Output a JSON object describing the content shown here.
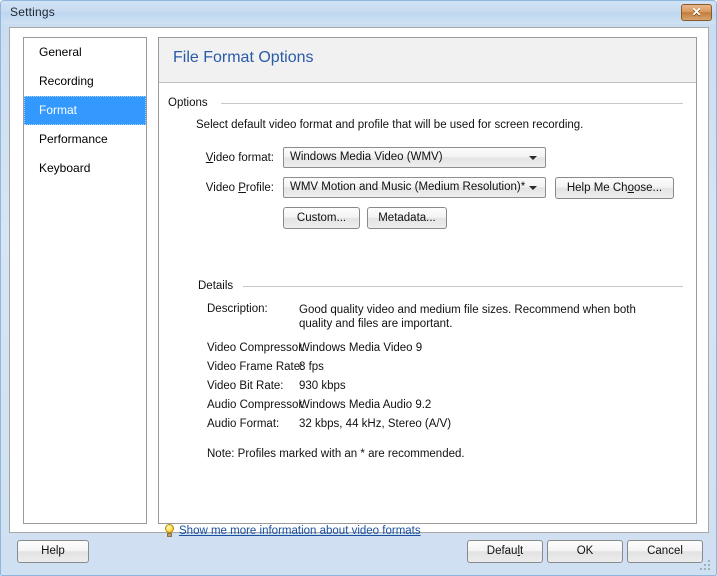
{
  "window": {
    "title": "Settings",
    "close_label": "✕",
    "accent_selected": "#3399ff",
    "title_color": "#2a5aa8",
    "link_color": "#1a4fa0"
  },
  "sidebar": {
    "items": [
      {
        "label": "General",
        "selected": false
      },
      {
        "label": "Recording",
        "selected": false
      },
      {
        "label": "Format",
        "selected": true
      },
      {
        "label": "Performance",
        "selected": false
      },
      {
        "label": "Keyboard",
        "selected": false
      }
    ]
  },
  "pane": {
    "header_title": "File Format Options",
    "options_group": {
      "legend": "Options",
      "intro": "Select default video format and profile that will be used for screen recording.",
      "video_format": {
        "label_pre": "",
        "label_accel": "V",
        "label_post": "ideo format:",
        "label_full": "Video format:",
        "value": "Windows Media Video (WMV)"
      },
      "video_profile": {
        "label_pre": "Video ",
        "label_accel": "P",
        "label_post": "rofile:",
        "label_full": "Video Profile:",
        "value": "WMV Motion and Music (Medium Resolution)*"
      },
      "help_me_choose": {
        "pre": "Help Me Ch",
        "accel": "o",
        "post": "ose...",
        "full": "Help Me Choose..."
      },
      "custom_button": "Custom...",
      "metadata_button": "Metadata..."
    },
    "details_group": {
      "legend": "Details",
      "rows": [
        {
          "label": "Description:",
          "value": "Good quality video and medium file sizes.  Recommend when both quality and files are important."
        },
        {
          "label": "Video Compressor:",
          "value": "Windows Media Video 9"
        },
        {
          "label": "Video Frame Rate:",
          "value": "8 fps"
        },
        {
          "label": "Video Bit Rate:",
          "value": "930 kbps"
        },
        {
          "label": "Audio Compressor:",
          "value": "Windows Media Audio 9.2"
        },
        {
          "label": "Audio Format:",
          "value": "32 kbps, 44 kHz, Stereo (A/V)"
        }
      ],
      "note": "Note:  Profiles marked with an *  are recommended."
    },
    "more_info_link": "Show me more information about video formats"
  },
  "footer": {
    "help": "Help",
    "default": {
      "pre": "Defau",
      "accel": "l",
      "post": "t",
      "full": "Default"
    },
    "ok": "OK",
    "cancel": "Cancel"
  }
}
